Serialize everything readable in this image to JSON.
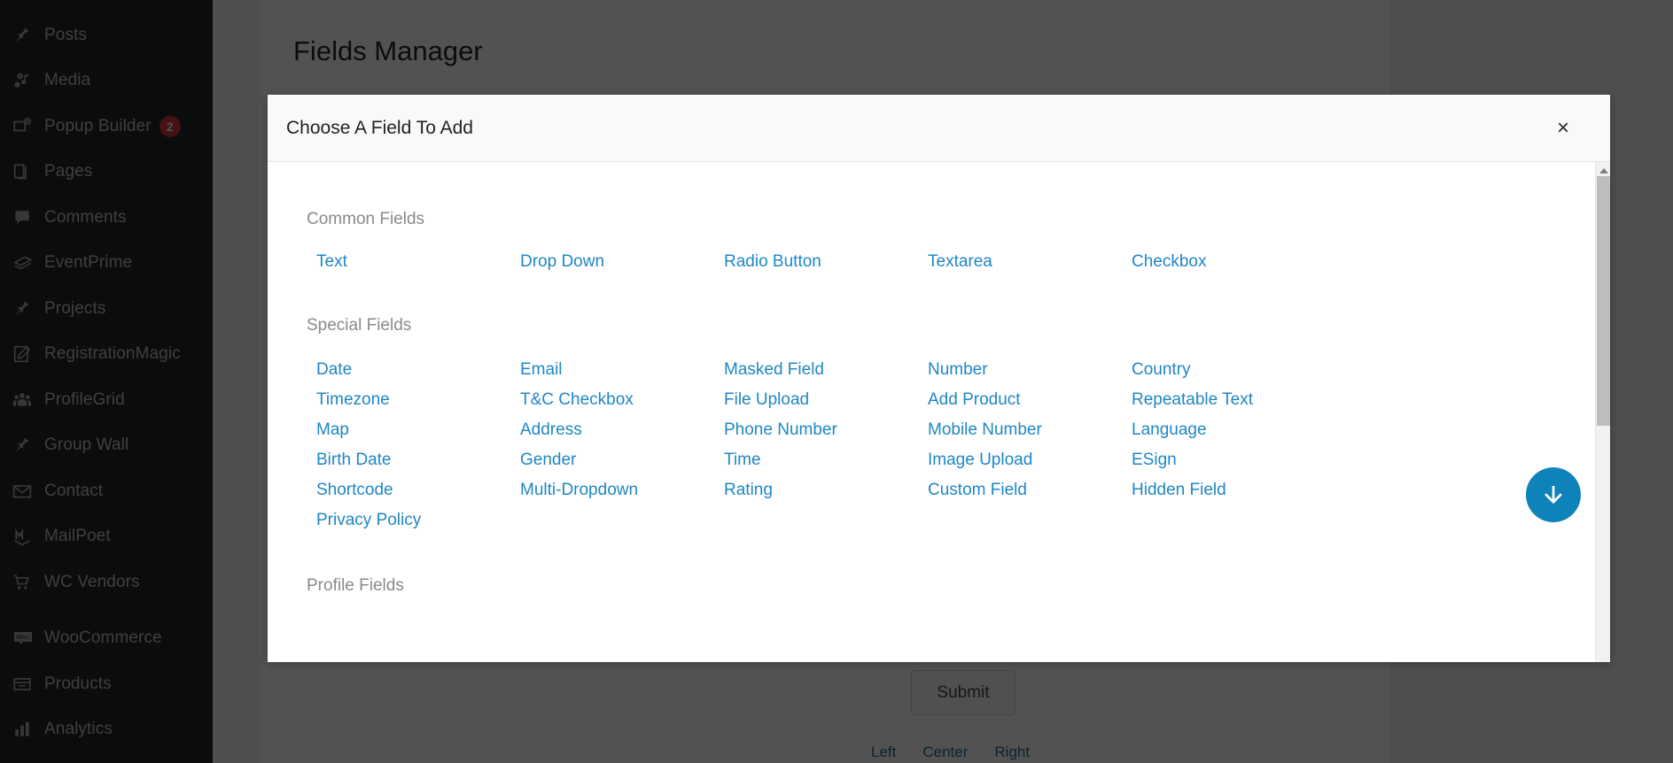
{
  "sidebar": {
    "items": [
      {
        "label": "Posts",
        "icon": "pin-icon",
        "badge": null
      },
      {
        "label": "Media",
        "icon": "media-icon",
        "badge": null
      },
      {
        "label": "Popup Builder",
        "icon": "popup-icon",
        "badge": "2"
      },
      {
        "label": "Pages",
        "icon": "pages-icon",
        "badge": null
      },
      {
        "label": "Comments",
        "icon": "comment-icon",
        "badge": null
      },
      {
        "label": "EventPrime",
        "icon": "ticket-icon",
        "badge": null
      },
      {
        "label": "Projects",
        "icon": "pin-icon",
        "badge": null
      },
      {
        "label": "RegistrationMagic",
        "icon": "form-edit-icon",
        "badge": null
      },
      {
        "label": "ProfileGrid",
        "icon": "people-icon",
        "badge": null
      },
      {
        "label": "Group Wall",
        "icon": "pin-icon",
        "badge": null
      },
      {
        "label": "Contact",
        "icon": "envelope-icon",
        "badge": null
      },
      {
        "label": "MailPoet",
        "icon": "mailpoet-icon",
        "badge": null
      },
      {
        "label": "WC Vendors",
        "icon": "cart-icon",
        "badge": null
      },
      {
        "label": "WooCommerce",
        "icon": "woocommerce-icon",
        "badge": null
      },
      {
        "label": "Products",
        "icon": "products-icon",
        "badge": null
      },
      {
        "label": "Analytics",
        "icon": "bar-chart-icon",
        "badge": null
      }
    ]
  },
  "page": {
    "title": "Fields Manager",
    "submit_label": "Submit",
    "align_options": [
      "Left",
      "Center",
      "Right"
    ]
  },
  "modal": {
    "title": "Choose A Field To Add",
    "close_label": "×",
    "sections": [
      {
        "title": "Common Fields",
        "fields": [
          "Text",
          "Drop Down",
          "Radio Button",
          "Textarea",
          "Checkbox"
        ]
      },
      {
        "title": "Special Fields",
        "fields": [
          "Date",
          "Email",
          "Masked Field",
          "Number",
          "Country",
          "Timezone",
          "T&C Checkbox",
          "File Upload",
          "Add Product",
          "Repeatable Text",
          "Map",
          "Address",
          "Phone Number",
          "Mobile Number",
          "Language",
          "Birth Date",
          "Gender",
          "Time",
          "Image Upload",
          "ESign",
          "Shortcode",
          "Multi-Dropdown",
          "Rating",
          "Custom Field",
          "Hidden Field",
          "Privacy Policy"
        ]
      },
      {
        "title": "Profile Fields",
        "fields": []
      }
    ],
    "scroll_down_icon": "arrow-down-icon"
  },
  "colors": {
    "link": "#1e87c4",
    "accent": "#0d83b9",
    "section_heading": "#8a8a8a",
    "sidebar_bg": "#23282d",
    "badge": "#d63638"
  }
}
